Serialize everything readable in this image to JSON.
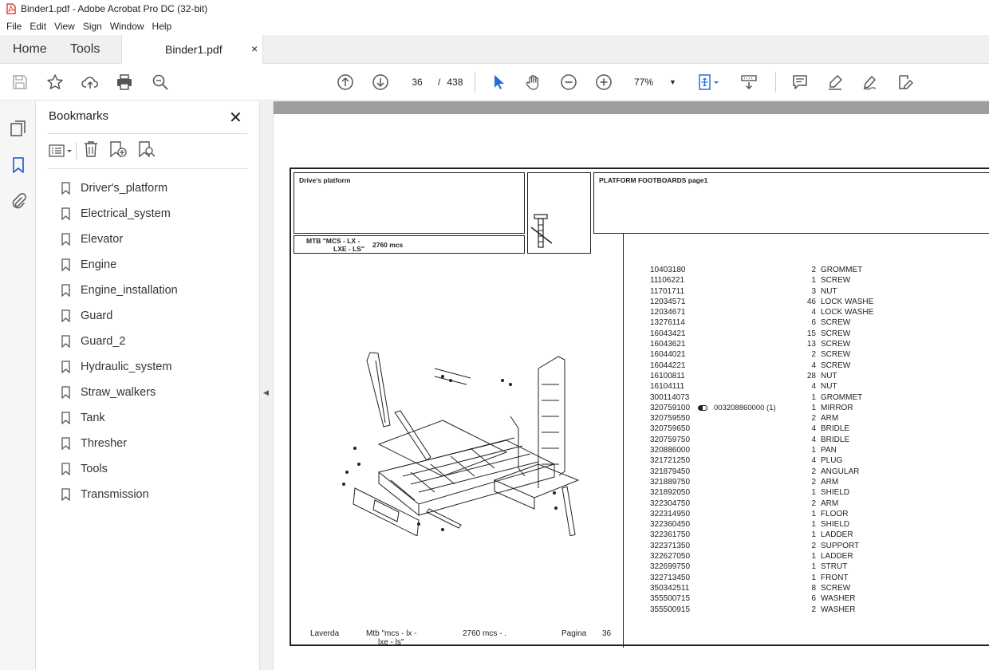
{
  "window": {
    "title": "Binder1.pdf - Adobe Acrobat Pro DC (32-bit)"
  },
  "menu": [
    "File",
    "Edit",
    "View",
    "Sign",
    "Window",
    "Help"
  ],
  "tabs": {
    "home": "Home",
    "tools": "Tools",
    "doc_tab": "Binder1.pdf",
    "close_glyph": "×"
  },
  "toolbar": {
    "page_current": "36",
    "page_sep": "/",
    "page_total": "438",
    "zoom": "77%"
  },
  "bookmarks": {
    "header": "Bookmarks",
    "close_glyph": "✕",
    "items": [
      "Driver's_platform",
      "Electrical_system",
      "Elevator",
      "Engine",
      "Engine_installation",
      "Guard",
      "Guard_2",
      "Hydraulic_system",
      "Straw_walkers",
      "Tank",
      "Thresher",
      "Tools",
      "Transmission"
    ]
  },
  "document": {
    "group_title": "Drive's platform",
    "model_line1": "MTB \"MCS - LX -",
    "model_line2": "LXE - LS\"",
    "model_code": "2760  mcs",
    "section_title": "PLATFORM FOOTBOARDS  page1",
    "parts": [
      {
        "pn": "10403180",
        "ex": "",
        "qty": "2",
        "desc": "GROMMET"
      },
      {
        "pn": "11106221",
        "ex": "",
        "qty": "1",
        "desc": "SCREW"
      },
      {
        "pn": "11701711",
        "ex": "",
        "qty": "3",
        "desc": "NUT"
      },
      {
        "pn": "12034571",
        "ex": "",
        "qty": "46",
        "desc": "LOCK WASHE"
      },
      {
        "pn": "12034671",
        "ex": "",
        "qty": "4",
        "desc": "LOCK WASHE"
      },
      {
        "pn": "13276114",
        "ex": "",
        "qty": "6",
        "desc": "SCREW"
      },
      {
        "pn": "16043421",
        "ex": "",
        "qty": "15",
        "desc": "SCREW"
      },
      {
        "pn": "16043621",
        "ex": "",
        "qty": "13",
        "desc": "SCREW"
      },
      {
        "pn": "16044021",
        "ex": "",
        "qty": "2",
        "desc": "SCREW"
      },
      {
        "pn": "16044221",
        "ex": "",
        "qty": "4",
        "desc": "SCREW"
      },
      {
        "pn": "16100811",
        "ex": "",
        "qty": "28",
        "desc": "NUT"
      },
      {
        "pn": "16104111",
        "ex": "",
        "qty": "4",
        "desc": "NUT"
      },
      {
        "pn": "300114073",
        "ex": "",
        "qty": "1",
        "desc": "GROMMET"
      },
      {
        "pn": "320759100",
        "ex": "003208860000  (1)",
        "qty": "1",
        "desc": "MIRROR"
      },
      {
        "pn": "320759550",
        "ex": "",
        "qty": "2",
        "desc": "ARM"
      },
      {
        "pn": "320759650",
        "ex": "",
        "qty": "4",
        "desc": "BRIDLE"
      },
      {
        "pn": "320759750",
        "ex": "",
        "qty": "4",
        "desc": "BRIDLE"
      },
      {
        "pn": "320886000",
        "ex": "",
        "qty": "1",
        "desc": "PAN"
      },
      {
        "pn": "321721250",
        "ex": "",
        "qty": "4",
        "desc": "PLUG"
      },
      {
        "pn": "321879450",
        "ex": "",
        "qty": "2",
        "desc": "ANGULAR"
      },
      {
        "pn": "321889750",
        "ex": "",
        "qty": "2",
        "desc": "ARM"
      },
      {
        "pn": "321892050",
        "ex": "",
        "qty": "1",
        "desc": "SHIELD"
      },
      {
        "pn": "322304750",
        "ex": "",
        "qty": "2",
        "desc": "ARM"
      },
      {
        "pn": "322314950",
        "ex": "",
        "qty": "1",
        "desc": "FLOOR"
      },
      {
        "pn": "322360450",
        "ex": "",
        "qty": "1",
        "desc": "SHIELD"
      },
      {
        "pn": "322361750",
        "ex": "",
        "qty": "1",
        "desc": "LADDER"
      },
      {
        "pn": "322371350",
        "ex": "",
        "qty": "2",
        "desc": "SUPPORT"
      },
      {
        "pn": "322627050",
        "ex": "",
        "qty": "1",
        "desc": "LADDER"
      },
      {
        "pn": "322699750",
        "ex": "",
        "qty": "1",
        "desc": "STRUT"
      },
      {
        "pn": "322713450",
        "ex": "",
        "qty": "1",
        "desc": "FRONT"
      },
      {
        "pn": "350342511",
        "ex": "",
        "qty": "8",
        "desc": "SCREW"
      },
      {
        "pn": "355500715",
        "ex": "",
        "qty": "6",
        "desc": "WASHER"
      },
      {
        "pn": "355500915",
        "ex": "",
        "qty": "2",
        "desc": "WASHER"
      }
    ],
    "footer": {
      "brand": "Laverda",
      "model1": "Mtb \"mcs - lx -",
      "model2": "lxe - ls\"",
      "code": "2760  mcs - .",
      "page_label": "Pagina",
      "page_no": "36"
    }
  },
  "colors": {
    "acrobat_red": "#d7261e",
    "icon_blue": "#2b6bd6",
    "icon_gray": "#555555"
  }
}
